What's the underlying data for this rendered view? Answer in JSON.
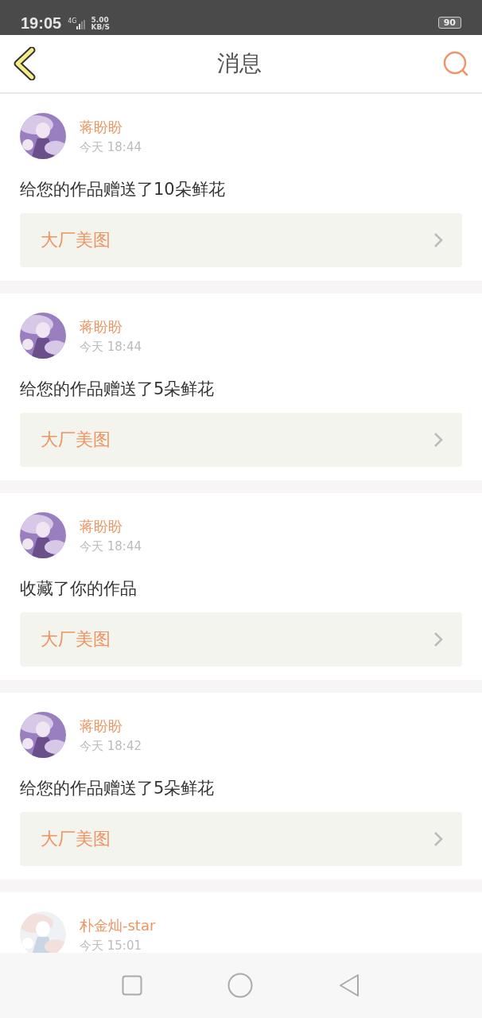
{
  "status_bar": {
    "time": "19:05",
    "network": "4G",
    "speed": "5.00",
    "speed_unit": "KB/S",
    "battery": "90"
  },
  "header": {
    "title": "消息"
  },
  "messages": [
    {
      "user": "蒋盼盼",
      "time": "今天 18:44",
      "text": "给您的作品赠送了10朵鲜花",
      "work": "大厂美图"
    },
    {
      "user": "蒋盼盼",
      "time": "今天 18:44",
      "text": "给您的作品赠送了5朵鲜花",
      "work": "大厂美图"
    },
    {
      "user": "蒋盼盼",
      "time": "今天 18:44",
      "text": "收藏了你的作品",
      "work": "大厂美图"
    },
    {
      "user": "蒋盼盼",
      "time": "今天 18:42",
      "text": "给您的作品赠送了5朵鲜花",
      "work": "大厂美图"
    },
    {
      "user": "朴金灿-star",
      "time": "今天 15:01"
    }
  ]
}
